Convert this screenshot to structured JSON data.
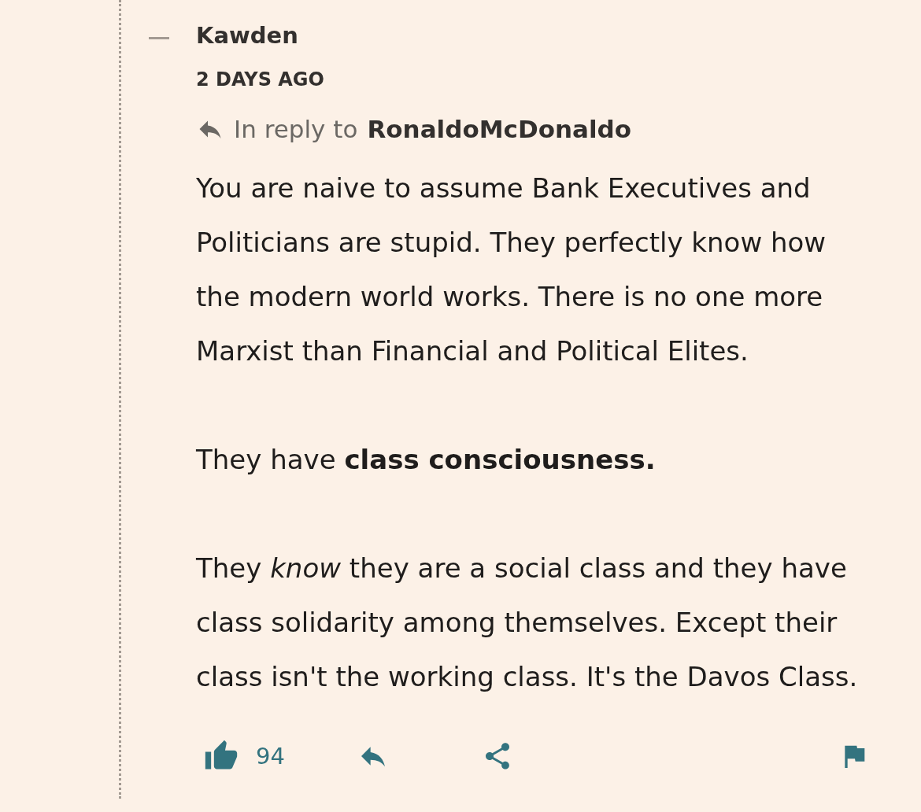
{
  "comment": {
    "expanded": true,
    "author": "Kawden",
    "timestamp": "2 DAYS AGO",
    "reply_to": {
      "prefix": "In reply to",
      "username": "RonaldoMcDonaldo"
    },
    "body": [
      "You are naive to assume Bank Executives and Politicians are stupid. They perfectly know how the modern world works. There is no one more Marxist than Financial and Political Elites.",
      "They have **class consciousness.**",
      "They *know* they are a social class and they have class solidarity among themselves. Except their class isn't the working class. It's the Davos Class."
    ],
    "actions": {
      "likes": "94"
    }
  }
}
